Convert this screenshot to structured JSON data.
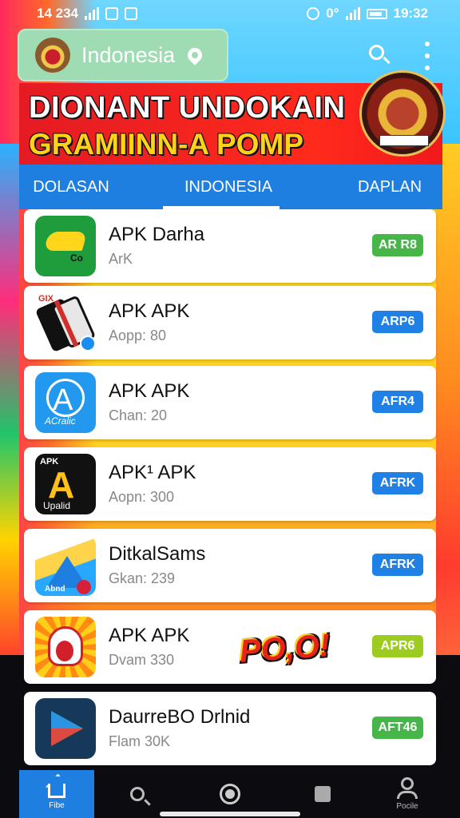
{
  "status_bar": {
    "left_time": "14 234",
    "right_indicator": "0°",
    "right_time": "19:32"
  },
  "app_bar": {
    "region": "Indonesia"
  },
  "banner": {
    "line1": "DIONANT UNDOKAIN",
    "line2": "GRAMIINN-A POMP"
  },
  "tabs": [
    {
      "label": "DOLASAN"
    },
    {
      "label": "INDONESIA"
    },
    {
      "label": "DAPLAN"
    }
  ],
  "apps": [
    {
      "title": "APK Darha",
      "subtitle": "ArK",
      "chip": "AR R8",
      "chip_color": "#47b649",
      "icon_text": "Co"
    },
    {
      "title": "APK APK",
      "subtitle": "Aopp: 80",
      "chip": "ARP6",
      "chip_color": "#1f80e6",
      "icon_text": "GIX"
    },
    {
      "title": "APK APK",
      "subtitle": "Chan: 20",
      "chip": "AFR4",
      "chip_color": "#1f80e6",
      "icon_text": "ACralic"
    },
    {
      "title": "APK¹ APK",
      "subtitle": "Aopn: 300",
      "chip": "AFRK",
      "chip_color": "#1f80e6",
      "icon_top": "APK",
      "icon_text": "Upalid"
    },
    {
      "title": "DitkalSams",
      "subtitle": "Gkan: 239",
      "chip": "AFRK",
      "chip_color": "#1f80e6",
      "icon_text": "Abnd"
    },
    {
      "title": "APK APK",
      "subtitle": "Dvam 330",
      "chip": "APR6",
      "chip_color": "#9ccc1f"
    },
    {
      "title": "DaurreBO Drlnid",
      "subtitle": "Flam 30K",
      "chip": "AFT46",
      "chip_color": "#47b649"
    }
  ],
  "promo_sticker": "PO,O!",
  "bottom_nav": {
    "home_label": "Fibe",
    "profile_label": "Pocile"
  }
}
